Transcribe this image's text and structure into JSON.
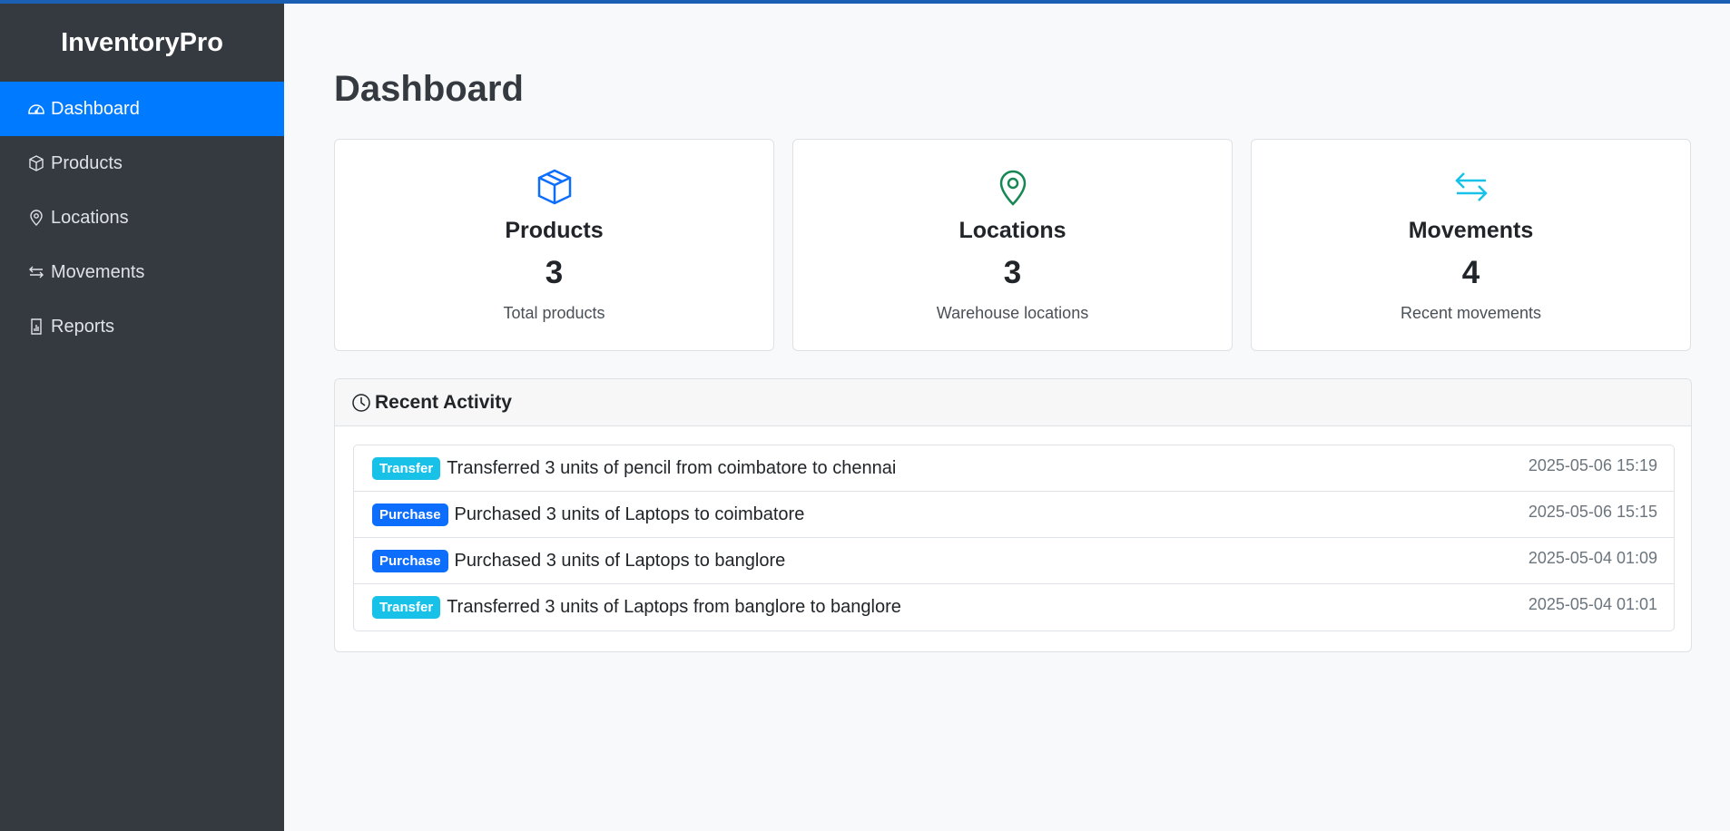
{
  "app": {
    "brand": "InventoryPro"
  },
  "colors": {
    "accent": "#007bff",
    "sidebar": "#343a40",
    "transfer": "#17c1e8",
    "purchase": "#0d6efd",
    "locations_icon": "#198754",
    "movements_icon": "#17c1e8",
    "products_icon": "#0d6efd"
  },
  "sidebar": {
    "items": [
      {
        "label": "Dashboard",
        "icon": "speedometer-icon",
        "active": true
      },
      {
        "label": "Products",
        "icon": "box-icon"
      },
      {
        "label": "Locations",
        "icon": "map-pin-icon"
      },
      {
        "label": "Movements",
        "icon": "arrows-exchange-icon"
      },
      {
        "label": "Reports",
        "icon": "bar-chart-file-icon"
      }
    ]
  },
  "main": {
    "title": "Dashboard",
    "cards": [
      {
        "title": "Products",
        "value": "3",
        "sub": "Total products",
        "icon": "box-icon"
      },
      {
        "title": "Locations",
        "value": "3",
        "sub": "Warehouse locations",
        "icon": "map-pin-icon"
      },
      {
        "title": "Movements",
        "value": "4",
        "sub": "Recent movements",
        "icon": "arrows-exchange-icon"
      }
    ],
    "activity": {
      "title": "Recent Activity",
      "icon": "clock-icon",
      "items": [
        {
          "badge": "Transfer",
          "text": "Transferred 3 units of pencil from coimbatore to chennai",
          "time": "2025-05-06 15:19"
        },
        {
          "badge": "Purchase",
          "text": "Purchased 3 units of Laptops to coimbatore",
          "time": "2025-05-06 15:15"
        },
        {
          "badge": "Purchase",
          "text": "Purchased 3 units of Laptops to banglore",
          "time": "2025-05-04 01:09"
        },
        {
          "badge": "Transfer",
          "text": "Transferred 3 units of Laptops from banglore to banglore",
          "time": "2025-05-04 01:01"
        }
      ]
    }
  }
}
